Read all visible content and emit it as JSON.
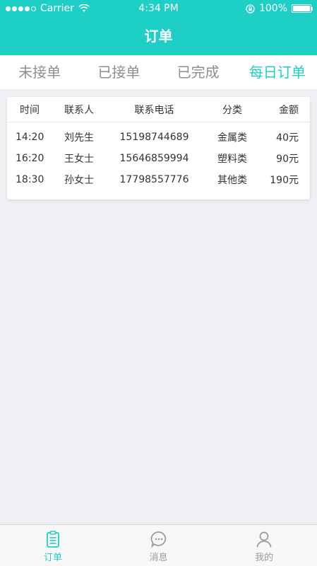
{
  "status_bar": {
    "carrier": "Carrier",
    "time": "4:34 PM",
    "battery": "100%"
  },
  "nav": {
    "title": "订单"
  },
  "tabs": [
    {
      "label": "未接单",
      "active": false
    },
    {
      "label": "已接单",
      "active": false
    },
    {
      "label": "已完成",
      "active": false
    },
    {
      "label": "每日订单",
      "active": true
    }
  ],
  "table": {
    "headers": [
      "时间",
      "联系人",
      "联系电话",
      "分类",
      "金额"
    ],
    "rows": [
      [
        "14:20",
        "刘先生",
        "15198744689",
        "金属类",
        "40元"
      ],
      [
        "16:20",
        "王女士",
        "15646859994",
        "塑料类",
        "90元"
      ],
      [
        "18:30",
        "孙女士",
        "17798557776",
        "其他类",
        "190元"
      ]
    ]
  },
  "tabbar": {
    "items": [
      {
        "label": "订单",
        "icon": "clipboard-icon",
        "active": true
      },
      {
        "label": "消息",
        "icon": "chat-bubble-icon",
        "active": false
      },
      {
        "label": "我的",
        "icon": "user-icon",
        "active": false
      }
    ]
  },
  "colors": {
    "accent": "#1ecfc5",
    "background": "#efeff4"
  }
}
